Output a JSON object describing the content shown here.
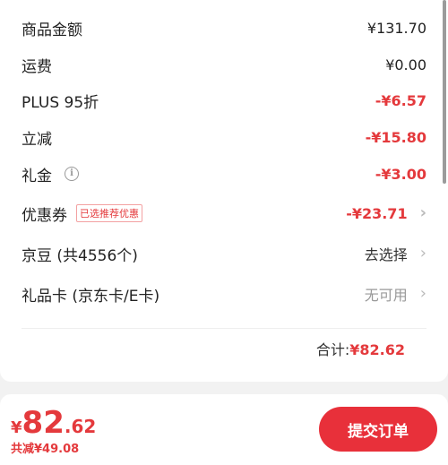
{
  "summary": {
    "goods_amount": {
      "label": "商品金额",
      "value": "¥131.70"
    },
    "shipping": {
      "label": "运费",
      "value": "¥0.00"
    },
    "plus_discount": {
      "label": "PLUS 95折",
      "value": "-¥6.57"
    },
    "instant_discount": {
      "label": "立减",
      "value": "-¥15.80"
    },
    "gift_money": {
      "label": "礼金",
      "value": "-¥3.00"
    },
    "coupon": {
      "label": "优惠券",
      "tag": "已选推荐优惠",
      "value": "-¥23.71"
    },
    "jingdou": {
      "label": "京豆 (共4556个)",
      "value": "去选择"
    },
    "gift_card": {
      "label": "礼品卡 (京东卡/E卡)",
      "value": "无可用"
    },
    "total": {
      "label": "合计:",
      "value": "¥82.62"
    }
  },
  "footer": {
    "currency": "¥",
    "price_int": "82",
    "price_dec": ".62",
    "saved": "共减¥49.08",
    "submit_label": "提交订单"
  }
}
